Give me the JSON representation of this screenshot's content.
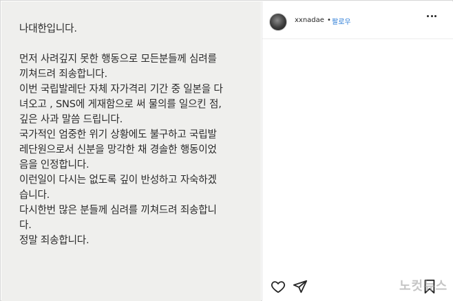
{
  "post": {
    "lines": [
      "나대한입니다.",
      "",
      "먼저 사려깊지 못한 행동으로 모든분들께 심려를",
      "끼쳐드려 죄송합니다.",
      "이번 국립발레단 자체 자가격리 기간 중 일본을 다",
      "녀오고 , SNS에 게재함으로 써 물의를 일으킨 점,",
      "깊은 사과 말씀 드립니다.",
      "국가적인 엄중한 위기 상황에도 불구하고 국립발",
      "레단원으로서 신분을 망각한 채 경솔한 행동이었",
      "음을 인정합니다.",
      "이런일이 다시는 없도록 깊이 반성하고 자숙하겠",
      "습니다.",
      "다시한번 많은 분들께 심려를 끼쳐드려 죄송합니",
      "다.",
      "정말 죄송합니다."
    ]
  },
  "header": {
    "username": "xxnadae",
    "separator": "•",
    "follow_label": "팔로우"
  },
  "icons": {
    "like": "heart-icon",
    "share": "send-icon",
    "save": "bookmark-icon",
    "more": "more-options-icon"
  },
  "watermark": "노컷뉴스"
}
